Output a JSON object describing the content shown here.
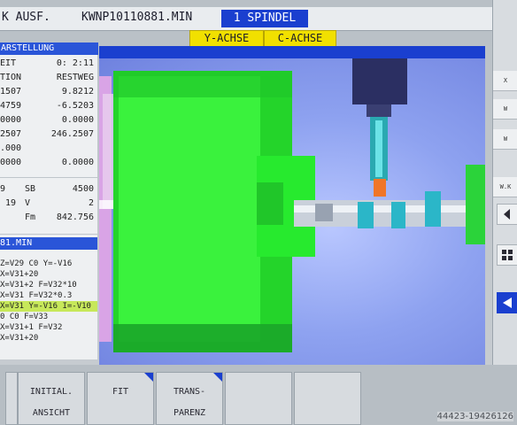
{
  "header": {
    "mode": "K AUSF.",
    "program": "KWNP10110881.MIN",
    "spindle": "1 SPINDEL",
    "axis_buttons": [
      "Y-ACHSE",
      "C-ACHSE"
    ]
  },
  "left_panel": {
    "title": "ARSTELLUNG",
    "rows": [
      {
        "a": "EIT",
        "b": "0: 2:11"
      },
      {
        "a": "TION",
        "b": "RESTWEG"
      },
      {
        "a": "1507",
        "b": "9.8212"
      },
      {
        "a": "4759",
        "b": "-6.5203"
      },
      {
        "a": "0000",
        "b": "0.0000"
      },
      {
        "a": "2507",
        "b": "246.2507"
      },
      {
        "a": ".000",
        "b": ""
      },
      {
        "a": "0000",
        "b": "0.0000"
      }
    ],
    "sb_rows": [
      {
        "a": "9",
        "c": "SB",
        "b": "4500"
      },
      {
        "a": "19",
        "c": "V",
        "b": "2"
      },
      {
        "a": "",
        "c": "Fm",
        "b": "842.756"
      }
    ],
    "program_title": "81.MIN",
    "code_lines": [
      "Z=V29 C0 Y=-V16",
      "X=V31+20",
      "X=V31+2 F=V32*10",
      "X=V31 F=V32*0.3",
      "X=V31 Y=-V16 I=-V10",
      "0 C0 F=V33",
      "X=V31+1 F=V32",
      "X=V31+20"
    ],
    "highlighted_line": 4
  },
  "softkeys": [
    {
      "l1": "",
      "l2": "",
      "marker": false
    },
    {
      "l1": "INITIAL.",
      "l2": "ANSICHT",
      "marker": false
    },
    {
      "l1": "FIT",
      "l2": "",
      "marker": true
    },
    {
      "l1": "TRANS-",
      "l2": "PARENZ",
      "marker": true
    },
    {
      "l1": "",
      "l2": "",
      "marker": false
    },
    {
      "l1": "",
      "l2": "",
      "marker": false
    }
  ],
  "right_panel": {
    "items": [
      "X",
      "W",
      "W",
      "W.K"
    ]
  },
  "watermark": "44423-19426126",
  "colors": {
    "accent_blue": "#1a3fcf",
    "highlight_yellow": "#f1e000",
    "workpiece_green": "#18e02a",
    "tool_cyan": "#20b7c6",
    "tool_navy": "#2a2f6a"
  }
}
